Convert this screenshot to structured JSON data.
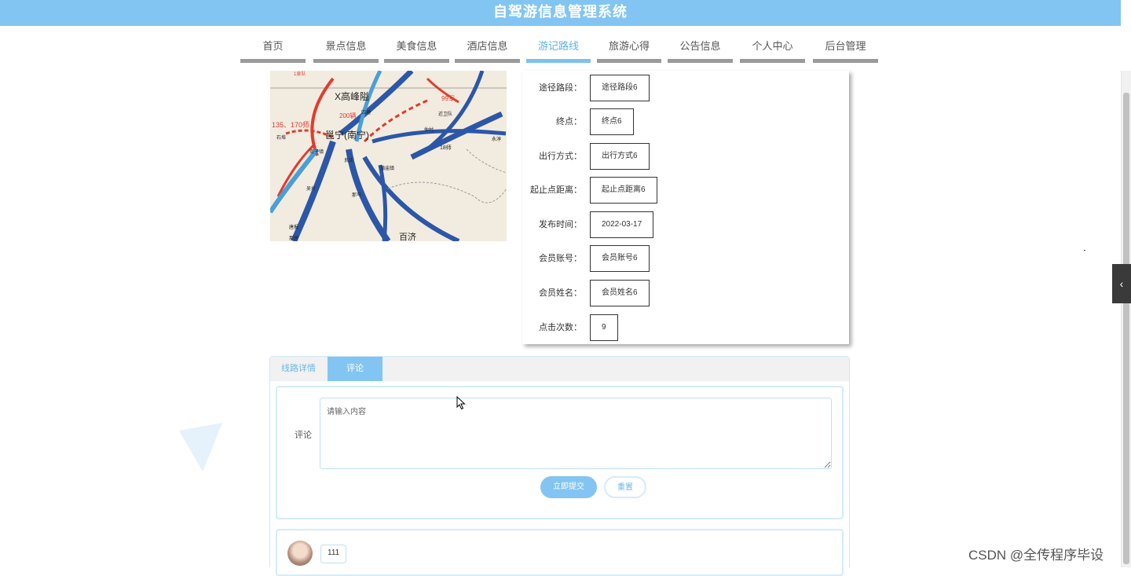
{
  "header": {
    "title": "自驾游信息管理系统"
  },
  "nav": {
    "items": [
      {
        "label": "首页"
      },
      {
        "label": "景点信息"
      },
      {
        "label": "美食信息"
      },
      {
        "label": "酒店信息"
      },
      {
        "label": "游记路线"
      },
      {
        "label": "旅游心得"
      },
      {
        "label": "公告信息"
      },
      {
        "label": "个人中心"
      },
      {
        "label": "后台管理"
      }
    ],
    "active": "游记路线"
  },
  "detail": {
    "fields": [
      {
        "label": "途径路段：",
        "value": "途径路段6"
      },
      {
        "label": "终点：",
        "value": "终点6"
      },
      {
        "label": "出行方式：",
        "value": "出行方式6"
      },
      {
        "label": "起止点距离：",
        "value": "起止点距离6"
      },
      {
        "label": "发布时间：",
        "value": "2022-03-17"
      },
      {
        "label": "会员账号：",
        "value": "会员账号6"
      },
      {
        "label": "会员姓名：",
        "value": "会员姓名6"
      },
      {
        "label": "点击次数：",
        "value": "9"
      }
    ]
  },
  "map": {
    "labels": [
      "1泉队",
      "X高峰隘",
      "99军",
      "200辆",
      "135、170师",
      "四塘",
      "邕宁(南宁)",
      "近卫队",
      "仲村",
      "石埠",
      "永淳",
      "奕子镇",
      "良庆",
      "蒲庙镇",
      "18师",
      "吴圩",
      "那马",
      "百济",
      "唐报",
      "那居"
    ]
  },
  "tabs": {
    "items": [
      {
        "label": "线路详情"
      },
      {
        "label": "评论"
      }
    ],
    "active": "评论"
  },
  "comment_form": {
    "label": "评论",
    "placeholder": "请输入内容",
    "submit_label": "立即提交",
    "reset_label": "重置"
  },
  "comments": [
    {
      "text": "111"
    }
  ],
  "watermark": "CSDN @全传程序毕设",
  "colors": {
    "primary": "#83c5f2",
    "nav_underline": "#9a9a9a",
    "border_light": "#d4ecfb"
  }
}
